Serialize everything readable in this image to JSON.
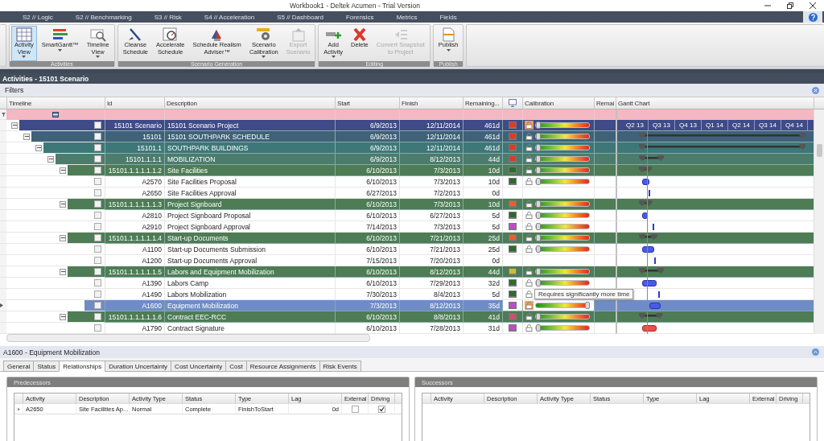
{
  "window": {
    "title": "Workbook1 - Deltek Acumen - Trial Version"
  },
  "menu": [
    {
      "label": "S2 // Logic",
      "selected": false
    },
    {
      "label": "S2 // Benchmarking",
      "selected": false
    },
    {
      "label": "S3 // Risk",
      "selected": false
    },
    {
      "label": "S4 // Acceleration",
      "selected": false
    },
    {
      "label": "S5 // Dashboard",
      "selected": false
    },
    {
      "label": "Forensics",
      "selected": false
    },
    {
      "label": "Metrics",
      "selected": false
    },
    {
      "label": "Fields",
      "selected": false
    }
  ],
  "ribbon": {
    "groups": [
      {
        "label": "Activities",
        "buttons": [
          {
            "label": "Activity\nView",
            "dropdown": true,
            "selected": true,
            "disabled": false
          },
          {
            "label": "SmartGantt™",
            "dropdown": true,
            "selected": false,
            "disabled": false
          },
          {
            "label": "Timeline\nView",
            "dropdown": true,
            "selected": false,
            "disabled": false
          }
        ]
      },
      {
        "label": "Scenario Generation",
        "buttons": [
          {
            "label": "Cleanse\nSchedule",
            "dropdown": false,
            "selected": false,
            "disabled": false
          },
          {
            "label": "Accelerate\nSchedule",
            "dropdown": false,
            "selected": false,
            "disabled": false
          },
          {
            "label": "Schedule Realism\nAdviser™",
            "dropdown": false,
            "selected": false,
            "disabled": false
          },
          {
            "label": "Scenario\nCalibration",
            "dropdown": true,
            "selected": false,
            "disabled": false
          },
          {
            "label": "Export\nScenario",
            "dropdown": false,
            "selected": false,
            "disabled": true
          }
        ]
      },
      {
        "label": "Editing",
        "buttons": [
          {
            "label": "Add\nActivity",
            "dropdown": true,
            "selected": false,
            "disabled": false
          },
          {
            "label": "Delete",
            "dropdown": false,
            "selected": false,
            "disabled": false
          },
          {
            "label": "Convert Snapshot\nto Project",
            "dropdown": false,
            "selected": false,
            "disabled": true
          }
        ]
      },
      {
        "label": "Publish",
        "buttons": [
          {
            "label": "Publish",
            "dropdown": true,
            "selected": false,
            "disabled": false
          }
        ]
      }
    ]
  },
  "section": {
    "title": "Activities - 15101 Scenario",
    "filters_label": "Filters"
  },
  "table": {
    "columns": [
      "Timeline",
      "Id",
      "Description",
      "Start",
      "Finish",
      "Remaining...",
      "",
      "Calibration",
      "Remai",
      "Gantt Chart"
    ],
    "quarters": [
      "Q2 13",
      "Q3 13",
      "Q4 13",
      "Q1 14",
      "Q2 14",
      "Q3 14",
      "Q4 14"
    ],
    "rows": [
      {
        "kind": "project",
        "id": "15101 Scenario",
        "description": "15101 Scenario Project",
        "start": "6/9/2013",
        "finish": "12/11/2014",
        "remaining": "461d",
        "selected": false,
        "expanded": true,
        "color": "#e03a25",
        "lock_on": true,
        "level": 0,
        "children": [
          {
            "kind": "summary",
            "id": "15101",
            "description": "15101 SOUTHPARK SCHEDULE",
            "start": "6/9/2013",
            "finish": "12/11/2014",
            "remaining": "461d",
            "selected": false,
            "expanded": true,
            "color": "#e03a25",
            "lock_on": false,
            "level": 0,
            "children": [
              {
                "kind": "summary",
                "id": "15101.1",
                "description": "SOUTHPARK BUILDINGS",
                "start": "6/9/2013",
                "finish": "12/11/2014",
                "remaining": "461d",
                "selected": false,
                "expanded": true,
                "color": "#e03a25",
                "lock_on": false,
                "level": 0,
                "children": [
                  {
                    "kind": "summary",
                    "id": "15101.1.1.1",
                    "description": "MOBILIZATION",
                    "start": "6/9/2013",
                    "finish": "8/12/2013",
                    "remaining": "44d",
                    "selected": false,
                    "expanded": true,
                    "color": "#e03a25",
                    "lock_on": false,
                    "level": 0,
                    "children": [
                      {
                        "kind": "summary",
                        "id": "15101.1.1.1.1.1.2",
                        "description": "Site Facilities",
                        "start": "6/10/2013",
                        "finish": "7/3/2013",
                        "remaining": "10d",
                        "selected": false,
                        "expanded": true,
                        "color": "#2e6a30",
                        "lock_on": false,
                        "level": 0,
                        "children": [
                          {
                            "kind": "task",
                            "id": "A2570",
                            "description": "Site Facilities Proposal",
                            "start": "6/10/2013",
                            "finish": "7/3/2013",
                            "remaining": "10d",
                            "selected": false,
                            "color": "#2e6a30",
                            "lock_on": false,
                            "level": 0
                          },
                          {
                            "kind": "milestone",
                            "id": "A2650",
                            "description": "Site Facilities Approval",
                            "start": "6/27/2013",
                            "finish": "7/2/2013",
                            "remaining": "0d",
                            "selected": false
                          }
                        ]
                      },
                      {
                        "kind": "summary",
                        "id": "15101.1.1.1.1.1.3",
                        "description": "Project Signboard",
                        "start": "6/10/2013",
                        "finish": "7/3/2013",
                        "remaining": "10d",
                        "selected": false,
                        "expanded": true,
                        "color": "#e8602c",
                        "lock_on": false,
                        "level": 0,
                        "children": [
                          {
                            "kind": "task",
                            "id": "A2810",
                            "description": "Project Signboard Proposal",
                            "start": "6/10/2013",
                            "finish": "6/27/2013",
                            "remaining": "5d",
                            "selected": false,
                            "color": "#2e6a30",
                            "lock_on": false,
                            "level": 0
                          },
                          {
                            "kind": "milestone",
                            "id": "A2910",
                            "description": "Project Signboard Approval",
                            "start": "7/14/2013",
                            "finish": "7/3/2013",
                            "remaining": "5d",
                            "selected": false,
                            "color": "#c04cc8",
                            "lock_on": false,
                            "level": 0
                          }
                        ]
                      },
                      {
                        "kind": "summary",
                        "id": "15101.1.1.1.1.1.4",
                        "description": "Start-up Documents",
                        "start": "6/10/2013",
                        "finish": "7/21/2013",
                        "remaining": "25d",
                        "selected": false,
                        "expanded": true,
                        "color": "#e8602c",
                        "lock_on": false,
                        "level": 0,
                        "children": [
                          {
                            "kind": "task",
                            "id": "A1100",
                            "description": "Start-up Documents Submission",
                            "start": "6/10/2013",
                            "finish": "7/21/2013",
                            "remaining": "25d",
                            "selected": false,
                            "color": "#2e6a30",
                            "lock_on": false,
                            "level": 0
                          },
                          {
                            "kind": "milestone",
                            "id": "A1200",
                            "description": "Start-up Documents Approval",
                            "start": "7/15/2013",
                            "finish": "7/20/2013",
                            "remaining": "0d",
                            "selected": false
                          }
                        ]
                      },
                      {
                        "kind": "summary",
                        "id": "15101.1.1.1.1.1.5",
                        "description": "Labors and Equipment Mobilization",
                        "start": "6/10/2013",
                        "finish": "8/12/2013",
                        "remaining": "44d",
                        "selected": false,
                        "expanded": true,
                        "color": "#c8c030",
                        "lock_on": false,
                        "level": 0,
                        "children": [
                          {
                            "kind": "task",
                            "id": "A1390",
                            "description": "Labors Camp",
                            "start": "6/10/2013",
                            "finish": "7/29/2013",
                            "remaining": "32d",
                            "selected": false,
                            "color": "#2e6a30",
                            "lock_on": false,
                            "level": 0
                          },
                          {
                            "kind": "milestone",
                            "id": "A1490",
                            "description": "Labors Mobilization",
                            "start": "7/30/2013",
                            "finish": "8/4/2013",
                            "remaining": "5d",
                            "selected": false,
                            "color": "#2e6a30",
                            "lock_on": false,
                            "level": 0,
                            "tooltip": "Requires significantly more time"
                          },
                          {
                            "kind": "task",
                            "id": "A1600",
                            "description": "Equipment Mobilization",
                            "start": "7/3/2013",
                            "finish": "8/12/2013",
                            "remaining": "35d",
                            "selected": true,
                            "color": "#c04cc8",
                            "lock_on": true,
                            "level": 1
                          }
                        ]
                      },
                      {
                        "kind": "summary",
                        "id": "15101.1.1.1.1.1.6",
                        "description": "Contract EEC-RCC",
                        "start": "6/10/2013",
                        "finish": "8/8/2013",
                        "remaining": "41d",
                        "selected": false,
                        "expanded": true,
                        "color": "#d84a6a",
                        "lock_on": false,
                        "level": 0,
                        "children": [
                          {
                            "kind": "critical",
                            "id": "A1790",
                            "description": "Contract Signature",
                            "start": "6/10/2013",
                            "finish": "7/28/2013",
                            "remaining": "31d",
                            "selected": false,
                            "color": "#c04cc8",
                            "lock_on": false,
                            "level": 0
                          }
                        ]
                      }
                    ]
                  }
                ]
              }
            ]
          }
        ]
      }
    ]
  },
  "details": {
    "title": "A1600 - Equipment Mobilization",
    "tabs": [
      {
        "label": "General",
        "selected": false
      },
      {
        "label": "Status",
        "selected": false
      },
      {
        "label": "Relationships",
        "selected": true
      },
      {
        "label": "Duration Uncertainty",
        "selected": false
      },
      {
        "label": "Cost Uncertainty",
        "selected": false
      },
      {
        "label": "Cost",
        "selected": false
      },
      {
        "label": "Resource Assignments",
        "selected": false
      },
      {
        "label": "Risk Events",
        "selected": false
      }
    ],
    "panels": [
      {
        "title": "Predecessors",
        "columns": [
          "Activity",
          "Description",
          "Activity Type",
          "Status",
          "Type",
          "Lag",
          "External",
          "Driving"
        ],
        "rows": [
          {
            "activity": "A2650",
            "description": "Site Facilities Ap...",
            "activity_type": "Normal",
            "status": "Complete",
            "type": "FinishToStart",
            "lag": "0d",
            "external": false,
            "driving": true
          }
        ]
      },
      {
        "title": "Successors",
        "columns": [
          "Activity",
          "Description",
          "Activity Type",
          "Status",
          "Type",
          "Lag",
          "External",
          "Driving"
        ]
      }
    ]
  }
}
